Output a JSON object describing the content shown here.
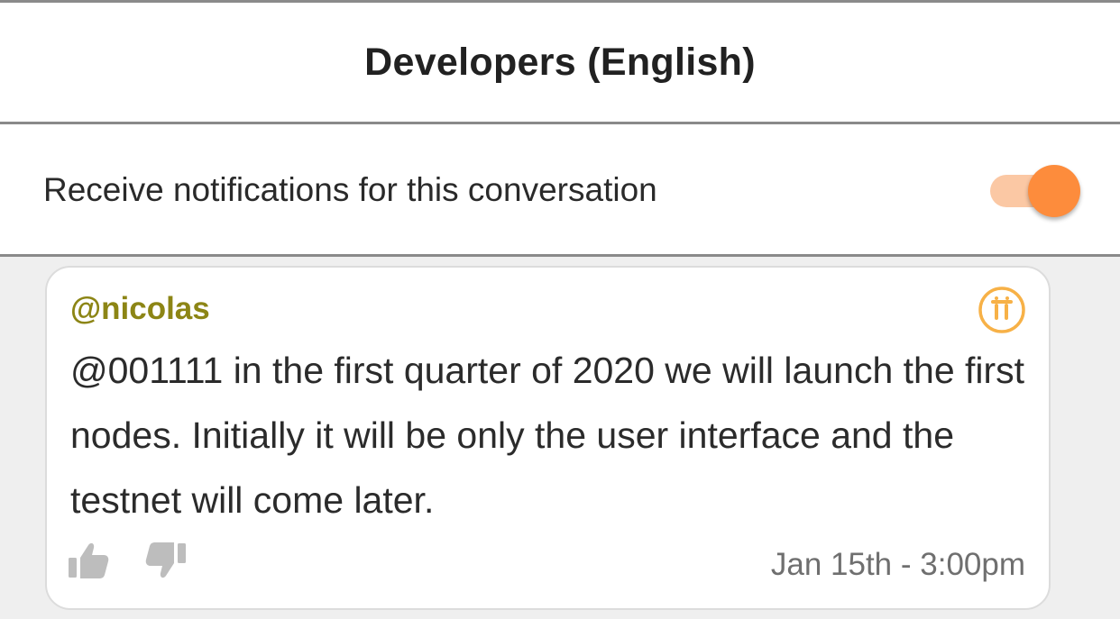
{
  "header": {
    "title": "Developers (English)"
  },
  "notifications": {
    "label": "Receive notifications for this conversation",
    "toggle_on": true
  },
  "message": {
    "author": "@nicolas",
    "text": "@001111 in the first quarter of 2020 we will launch the first nodes. Initially it will be only the user interface and the testnet will come later.",
    "timestamp": "Jan 15th - 3:00pm",
    "badge_icon": "pi-logo-icon",
    "reaction_icons": [
      "thumbs-up-icon",
      "thumbs-down-icon"
    ]
  },
  "colors": {
    "accent": "#fd8c3c",
    "accent_light": "#fbc8a4",
    "author": "#8c8515",
    "badge": "#f7b147",
    "reaction_icon": "#bdbdbd"
  }
}
